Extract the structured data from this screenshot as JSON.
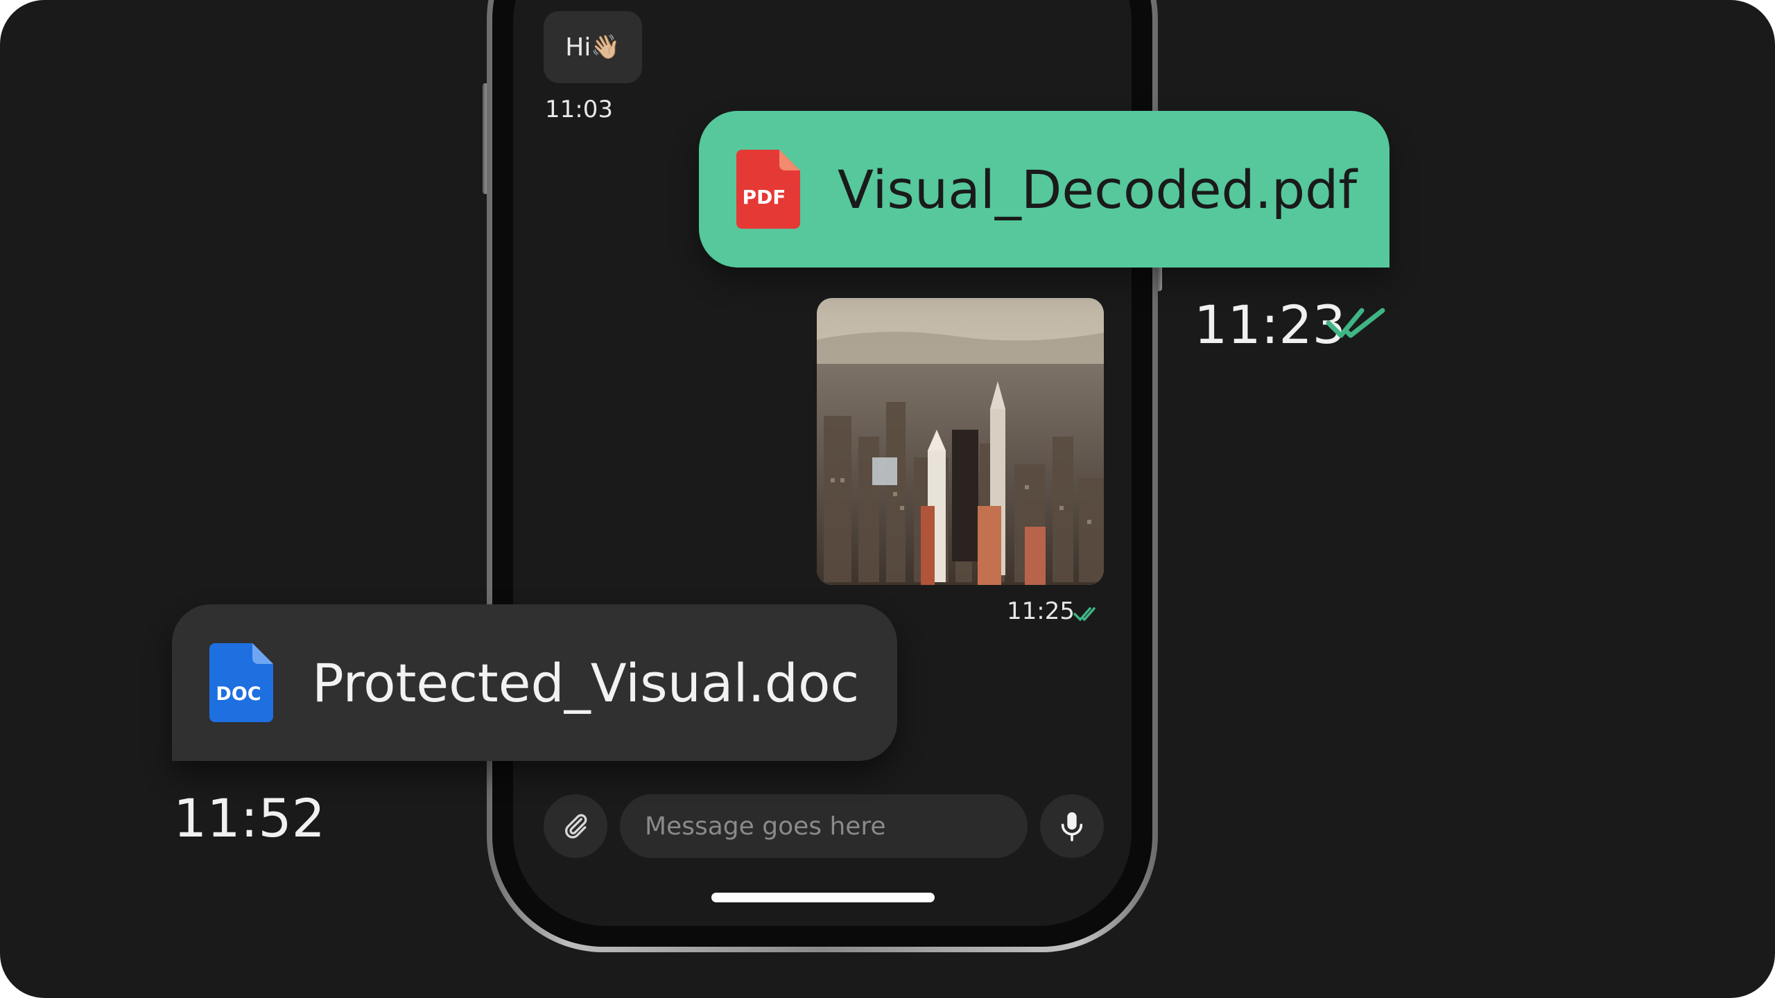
{
  "chat": {
    "greeting": {
      "text": "Hi",
      "emoji": "👋🏼",
      "time": "11:03"
    },
    "photo_message": {
      "time": "11:25",
      "status": "read"
    },
    "composer": {
      "placeholder": "Message goes here",
      "value": ""
    }
  },
  "files": {
    "pdf": {
      "badge": "PDF",
      "name": "Visual_Decoded.pdf",
      "time": "11:23",
      "status": "read"
    },
    "doc": {
      "badge": "DOC",
      "name": "Protected_Visual.doc",
      "time": "11:52"
    }
  },
  "icons": {
    "attach": "paperclip-icon",
    "mic": "microphone-icon",
    "read_receipt": "double-check-icon",
    "pdf_file": "pdf-file-icon",
    "doc_file": "doc-file-icon"
  },
  "colors": {
    "background": "#1a1a1a",
    "accent_green": "#56c89c",
    "read_check": "#3fb585",
    "pdf_red": "#e53935",
    "doc_blue": "#1e6fe0",
    "incoming_bubble": "#2e2e2e",
    "doc_card": "#303030"
  }
}
